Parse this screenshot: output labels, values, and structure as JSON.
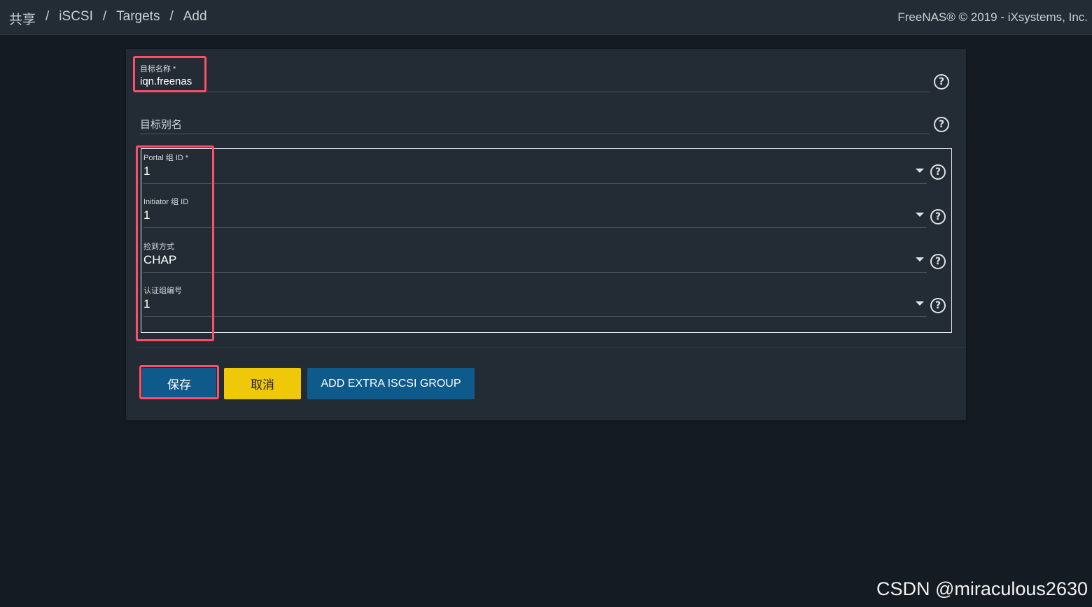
{
  "breadcrumb": [
    "共享",
    "iSCSI",
    "Targets",
    "Add"
  ],
  "breadcrumb_separator": "/",
  "copyright": "FreeNAS® © 2019 - iXsystems, Inc.",
  "form": {
    "target_name": {
      "label": "目标名称 *",
      "value": "iqn.freenas"
    },
    "target_alias": {
      "placeholder": "目标别名",
      "value": ""
    },
    "group": {
      "portal_group": {
        "label": "Portal 组 ID *",
        "value": "1"
      },
      "initiator_group": {
        "label": "Initiator 组 ID",
        "value": "1"
      },
      "auth_method": {
        "label": "捡到方式",
        "value": "CHAP"
      },
      "auth_group": {
        "label": "认证组编号",
        "value": "1"
      }
    },
    "help_glyph": "?"
  },
  "buttons": {
    "save": "保存",
    "cancel": "取消",
    "add_group": "ADD EXTRA ISCSI GROUP"
  },
  "watermark": "CSDN @miraculous2630",
  "colors": {
    "primary": "#0d5a8b",
    "cancel": "#f0c80a",
    "highlight": "#ff4d6a",
    "card": "#232c35",
    "background": "#151b23"
  }
}
